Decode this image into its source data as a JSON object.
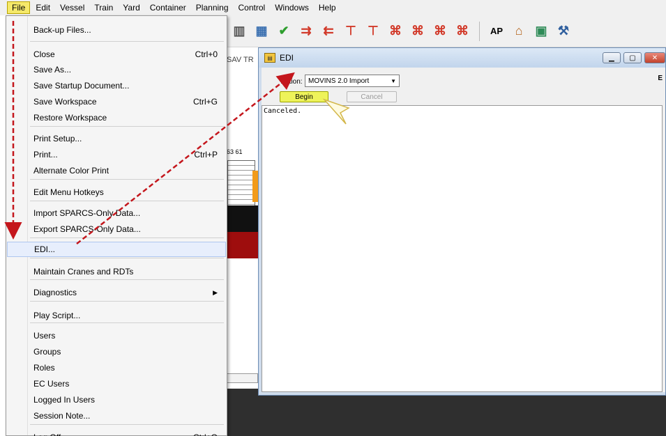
{
  "menubar": {
    "items": [
      "File",
      "Edit",
      "Vessel",
      "Train",
      "Yard",
      "Container",
      "Planning",
      "Control",
      "Windows",
      "Help"
    ]
  },
  "toolbar": {
    "icons": [
      "grid-icon",
      "table-icon",
      "check-icon",
      "move-right-icon",
      "move-left-icon",
      "pin-icon",
      "pin-icon",
      "crane-icon",
      "crane-icon",
      "crane-icon",
      "crane-icon"
    ],
    "ap_label": "AP"
  },
  "background": {
    "tab_label": "SAV TR",
    "numbers": "63 61"
  },
  "file_menu": {
    "items": [
      {
        "label": "Back-up Files...",
        "shortcut": ""
      },
      {
        "label": "Close",
        "shortcut": "Ctrl+0"
      },
      {
        "label": "Save As...",
        "shortcut": ""
      },
      {
        "label": "Save Startup Document...",
        "shortcut": ""
      },
      {
        "label": "Save Workspace",
        "shortcut": "Ctrl+G"
      },
      {
        "label": "Restore Workspace",
        "shortcut": ""
      },
      {
        "label": "Print Setup...",
        "shortcut": ""
      },
      {
        "label": "Print...",
        "shortcut": "Ctrl+P"
      },
      {
        "label": "Alternate Color Print",
        "shortcut": ""
      },
      {
        "label": "Edit Menu Hotkeys",
        "shortcut": ""
      },
      {
        "label": "Import SPARCS-Only Data...",
        "shortcut": ""
      },
      {
        "label": "Export SPARCS-Only Data...",
        "shortcut": ""
      },
      {
        "label": "EDI...",
        "shortcut": ""
      },
      {
        "label": "Maintain Cranes and RDTs",
        "shortcut": ""
      },
      {
        "label": "Diagnostics",
        "shortcut": ""
      },
      {
        "label": "Play Script...",
        "shortcut": ""
      },
      {
        "label": "Users",
        "shortcut": ""
      },
      {
        "label": "Groups",
        "shortcut": ""
      },
      {
        "label": "Roles",
        "shortcut": ""
      },
      {
        "label": "EC Users",
        "shortcut": ""
      },
      {
        "label": "Logged In Users",
        "shortcut": ""
      },
      {
        "label": "Session Note...",
        "shortcut": ""
      },
      {
        "label": "Log Off...",
        "shortcut": "Ctrl+Q"
      }
    ]
  },
  "edi_window": {
    "title": "EDI",
    "action_label": "Action:",
    "action_value": "MOVINS 2.0 Import",
    "begin_label": "Begin",
    "cancel_label": "Cancel",
    "output_text": "Canceled.",
    "corner_letter": "E"
  },
  "annotation_color": "#c4161c"
}
